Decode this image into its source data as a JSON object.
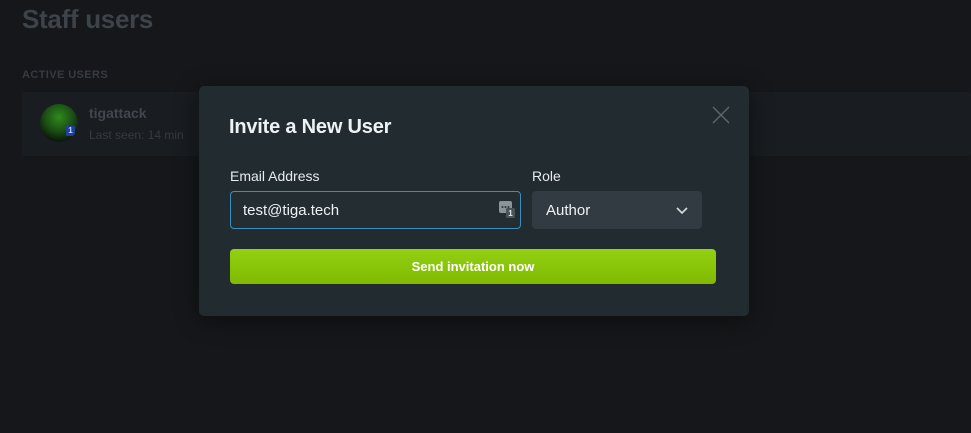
{
  "page": {
    "title": "Staff users",
    "section_label": "ACTIVE USERS"
  },
  "user": {
    "name": "tigattack",
    "last_seen": "Last seen: 14 min",
    "avatar_badge": "1"
  },
  "modal": {
    "title": "Invite a New User",
    "email_label": "Email Address",
    "email_value": "test@tiga.tech",
    "autofill_badge": "1",
    "role_label": "Role",
    "role_value": "Author",
    "send_label": "Send invitation now"
  },
  "icons": {
    "close": "close-icon",
    "chevron": "chevron-down-icon",
    "autofill": "password-manager-icon"
  },
  "colors": {
    "background": "#15171a",
    "modal": "#222b30",
    "accent_green": "#85c11a",
    "input_focus": "#3a8fc0"
  }
}
